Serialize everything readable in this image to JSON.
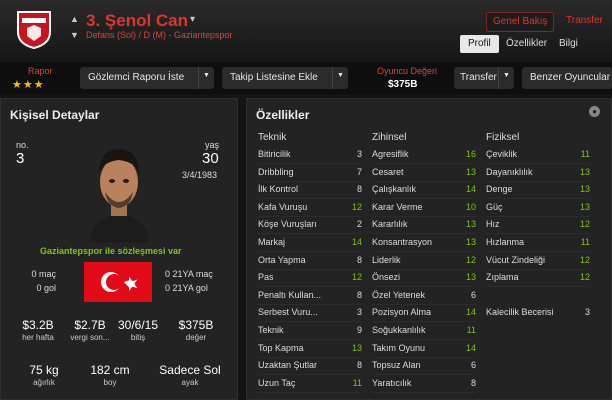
{
  "header": {
    "player_name": "3. Şenol Can",
    "subtitle": "Defans (Sol) / D (M) - Gaziantepspor",
    "overview_button": "Genel Bakış",
    "transfer_top": "Transfer",
    "tabs": [
      "Profil",
      "Özellikler",
      "Bilgi"
    ]
  },
  "toolbar": {
    "rating_label": "Rapor",
    "rating_stars": "★★★",
    "scout_button": "Gözlemci Raporu İste",
    "shortlist_button": "Takip Listesine Ekle",
    "value_label": "Oyuncu Değeri",
    "value_amount": "$375B",
    "transfer_button": "Transfer",
    "similar_button": "Benzer Oyuncular"
  },
  "personal": {
    "title": "Kişisel Detaylar",
    "no_label": "no.",
    "no_value": "3",
    "age_label": "yaş",
    "age_value": "30",
    "dob": "3/4/1983",
    "contract_text": "Gaziantepspor ile sözleşmesi var",
    "apps": "0 maç",
    "goals": "0 gol",
    "u21_apps": "0 21YA maç",
    "u21_goals": "0 21YA gol",
    "finance": [
      {
        "value": "$3.2B",
        "label": "her hafta"
      },
      {
        "value": "$2.7B",
        "label": "vergi son..."
      },
      {
        "value": "30/6/15",
        "label": "bitiş"
      },
      {
        "value": "$375B",
        "label": "değer"
      }
    ],
    "physical": [
      {
        "value": "75 kg",
        "label": "ağırlık"
      },
      {
        "value": "182 cm",
        "label": "boy"
      },
      {
        "value": "Sadece Sol",
        "label": "ayak"
      }
    ]
  },
  "attributes": {
    "title": "Özellikler",
    "technical_title": "Teknik",
    "mental_title": "Zihinsel",
    "physical_title": "Fiziksel",
    "technical": [
      {
        "name": "Bitiricilik",
        "value": "3"
      },
      {
        "name": "Dribbling",
        "value": "7"
      },
      {
        "name": "İlk Kontrol",
        "value": "8"
      },
      {
        "name": "Kafa Vuruşu",
        "value": "12"
      },
      {
        "name": "Köşe Vuruşları",
        "value": "2"
      },
      {
        "name": "Markaj",
        "value": "14"
      },
      {
        "name": "Orta Yapma",
        "value": "8"
      },
      {
        "name": "Pas",
        "value": "12"
      },
      {
        "name": "Penaltı Kullan...",
        "value": "8"
      },
      {
        "name": "Serbest Vuru...",
        "value": "3"
      },
      {
        "name": "Teknik",
        "value": "9"
      },
      {
        "name": "Top Kapma",
        "value": "13"
      },
      {
        "name": "Uzaktan Şutlar",
        "value": "8"
      },
      {
        "name": "Uzun Taç",
        "value": "11"
      }
    ],
    "mental": [
      {
        "name": "Agresiflik",
        "value": "16"
      },
      {
        "name": "Cesaret",
        "value": "13"
      },
      {
        "name": "Çalışkanlık",
        "value": "14"
      },
      {
        "name": "Karar Verme",
        "value": "10"
      },
      {
        "name": "Kararlılık",
        "value": "13"
      },
      {
        "name": "Konsantrasyon",
        "value": "13"
      },
      {
        "name": "Liderlik",
        "value": "12"
      },
      {
        "name": "Önsezi",
        "value": "13"
      },
      {
        "name": "Özel Yetenek",
        "value": "6"
      },
      {
        "name": "Pozisyon Alma",
        "value": "14"
      },
      {
        "name": "Soğukkanlılık",
        "value": "11"
      },
      {
        "name": "Takım Oyunu",
        "value": "14"
      },
      {
        "name": "Topsuz Alan",
        "value": "6"
      },
      {
        "name": "Yaratıcılık",
        "value": "8"
      }
    ],
    "physical": [
      {
        "name": "Çeviklik",
        "value": "11"
      },
      {
        "name": "Dayanıklılık",
        "value": "13"
      },
      {
        "name": "Denge",
        "value": "13"
      },
      {
        "name": "Güç",
        "value": "13"
      },
      {
        "name": "Hız",
        "value": "12"
      },
      {
        "name": "Hızlanma",
        "value": "11"
      },
      {
        "name": "Vücut Zindeliği",
        "value": "12"
      },
      {
        "name": "Zıplama",
        "value": "12"
      }
    ],
    "goalkeeping_label": "Kalecilik Becerisi",
    "goalkeeping_value": "3"
  },
  "colors": {
    "accent": "#e0352b",
    "good": "#7fc41a",
    "stars": "#f2c400"
  }
}
